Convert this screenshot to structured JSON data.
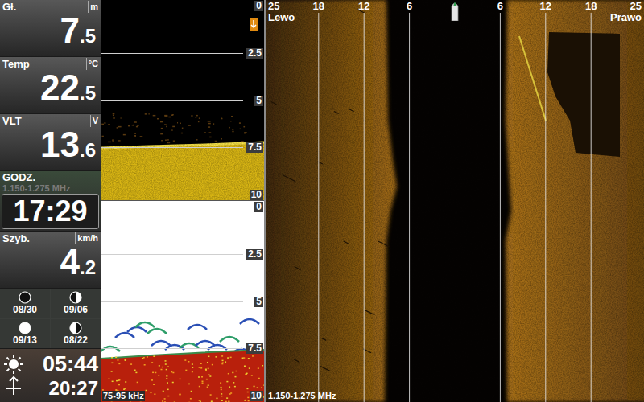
{
  "readouts": [
    {
      "label": "Gł.",
      "unit": "m",
      "whole": "7",
      "fraction": ".5"
    },
    {
      "label": "Temp",
      "unit": "°C",
      "whole": "22",
      "fraction": ".5"
    },
    {
      "label": "VLT",
      "unit": "V",
      "whole": "13",
      "fraction": ".6"
    }
  ],
  "clock": {
    "label": "GODZ.",
    "ghost": "1.150-1.275 MHz",
    "time": "17:29"
  },
  "speed": {
    "label": "Szyb.",
    "unit": "km/h",
    "whole": "4",
    "fraction": ".2"
  },
  "moon_phases": [
    {
      "date": "08/30",
      "kind": "new"
    },
    {
      "date": "09/06",
      "kind": "first-quarter"
    },
    {
      "date": "09/13",
      "kind": "full"
    },
    {
      "date": "08/22",
      "kind": "last-quarter"
    }
  ],
  "sun": {
    "sunrise": "05:44",
    "sunset": "20:27"
  },
  "sonar_2d": [
    {
      "kind": "high",
      "scale": [
        "0",
        "2.5",
        "5",
        "7.5",
        "10"
      ]
    },
    {
      "kind": "low",
      "scale": [
        "0",
        "2.5",
        "5",
        "7.5",
        "10"
      ],
      "frequency": "75-95 kHz"
    }
  ],
  "side_imaging": {
    "left_label": "Lewo",
    "right_label": "Prawo",
    "left_ranges": [
      "25",
      "18",
      "12",
      "6"
    ],
    "right_ranges": [
      "6",
      "12",
      "18",
      "25"
    ],
    "frequency": "1.150-1.275 MHz"
  }
}
